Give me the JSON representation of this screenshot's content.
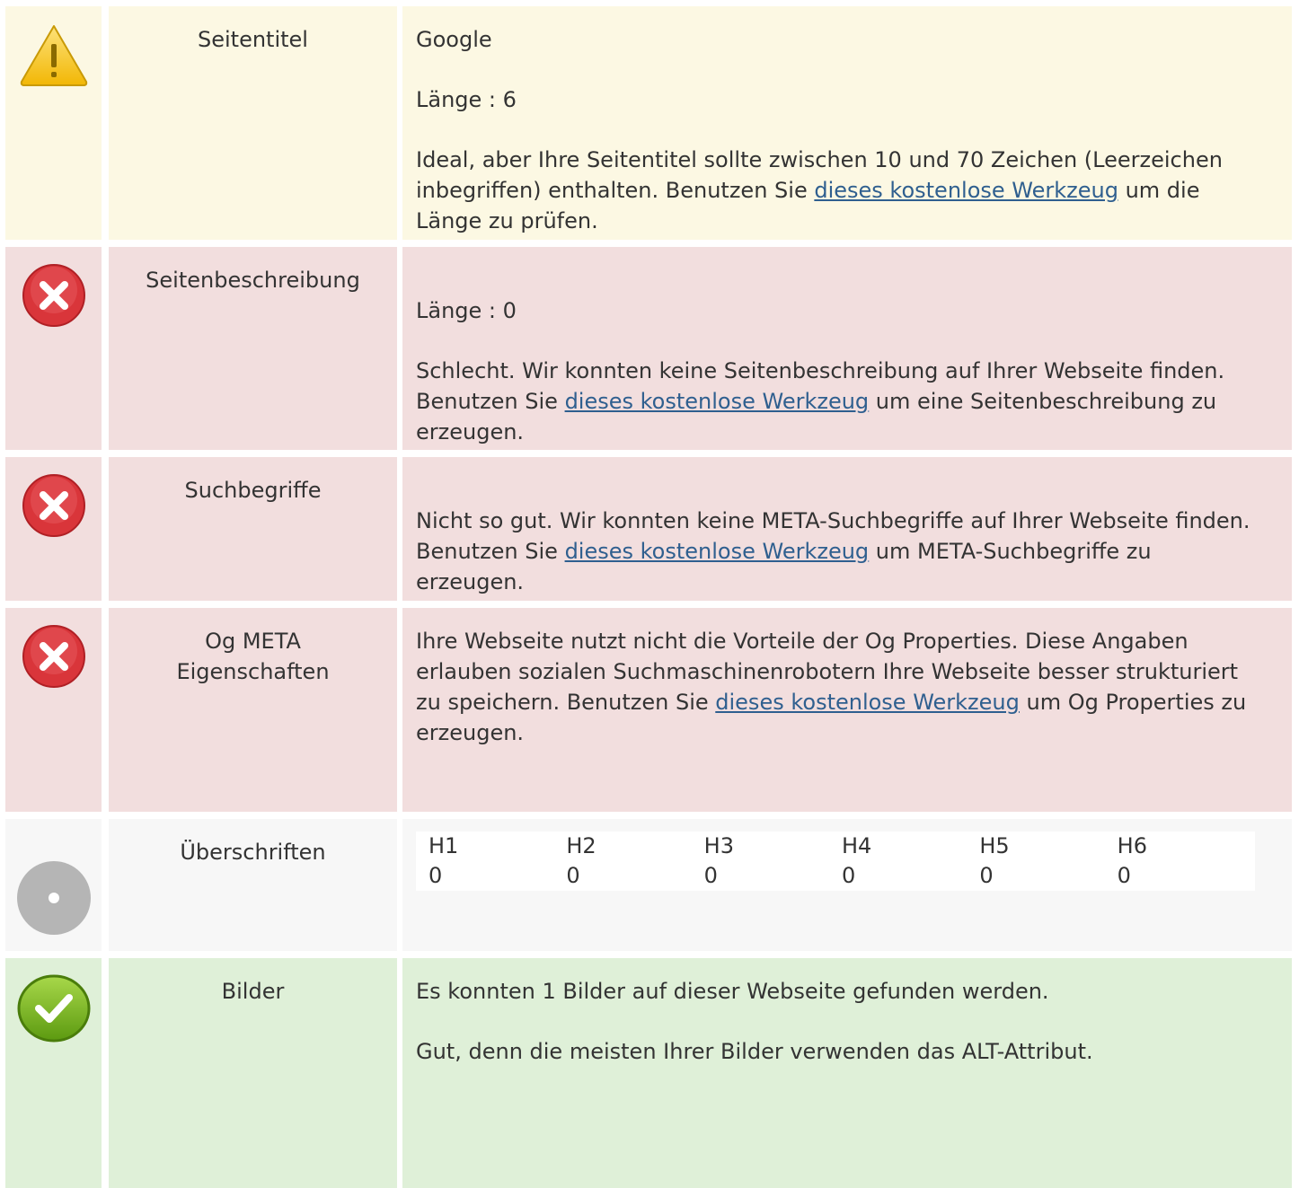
{
  "rows": {
    "title": {
      "label": "Seitentitel",
      "value": "Google",
      "length": "Länge : 6",
      "text_before": "Ideal, aber Ihre Seitentitel sollte zwischen 10 und 70 Zeichen (Leerzeichen inbegriffen) enthalten. Benutzen Sie ",
      "link": "dieses kostenlose Werkzeug",
      "text_after": " um die Länge zu prüfen.",
      "icon": "warning-icon",
      "bg": "#fcf8e3"
    },
    "description": {
      "label": "Seitenbeschreibung",
      "length": "Länge : 0",
      "text_before": "Schlecht. Wir konnten keine Seitenbeschreibung auf Ihrer Webseite finden. Benutzen Sie ",
      "link": "dieses kostenlose Werkzeug",
      "text_after": " um eine Seitenbeschreibung zu erzeugen.",
      "icon": "error-icon",
      "bg": "#f2dede"
    },
    "keywords": {
      "label": "Suchbegriffe",
      "text_before": "Nicht so gut. Wir konnten keine META-Suchbegriffe auf Ihrer Webseite finden. Benutzen Sie ",
      "link": "dieses kostenlose Werkzeug",
      "text_after": " um META-Suchbegriffe zu erzeugen.",
      "icon": "error-icon",
      "bg": "#f2dede"
    },
    "og": {
      "label": "Og META Eigenschaften",
      "text_before": "Ihre Webseite nutzt nicht die Vorteile der Og Properties. Diese Angaben erlauben sozialen Suchmaschinenrobotern Ihre Webseite besser strukturiert zu speichern. Benutzen Sie ",
      "link": "dieses kostenlose Werkzeug",
      "text_after": " um Og Properties zu erzeugen.",
      "icon": "error-icon",
      "bg": "#f2dede"
    },
    "headings": {
      "label": "Überschriften",
      "columns": [
        {
          "h": "H1",
          "v": "0"
        },
        {
          "h": "H2",
          "v": "0"
        },
        {
          "h": "H3",
          "v": "0"
        },
        {
          "h": "H4",
          "v": "0"
        },
        {
          "h": "H5",
          "v": "0"
        },
        {
          "h": "H6",
          "v": "0"
        }
      ],
      "icon": "neutral-icon",
      "bg": "#f7f7f7"
    },
    "images": {
      "label": "Bilder",
      "line1": "Es konnten 1 Bilder auf dieser Webseite gefunden werden.",
      "line2": "Gut, denn die meisten Ihrer Bilder verwenden das ALT-Attribut.",
      "icon": "check-icon",
      "bg": "#dff0d8"
    }
  },
  "colors": {
    "link": "#2f5f8f",
    "warning": "#f5c518",
    "error": "#d9353a",
    "success": "#7cb518",
    "neutral": "#aaaaaa"
  }
}
